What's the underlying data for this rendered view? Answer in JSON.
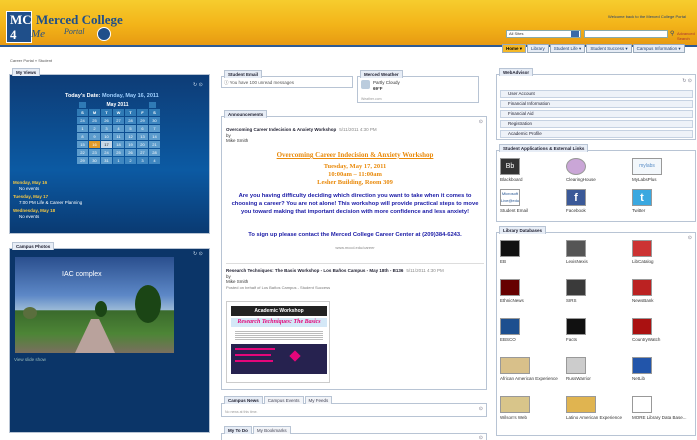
{
  "brand": {
    "name": "Merced College",
    "portal": "Portal",
    "logo_top": "MC",
    "logo_bottom": "4",
    "logo_me": "Me"
  },
  "header": {
    "welcome": "Welcome back to the Merced College Portal",
    "search_scope": "All Sites",
    "search_value": "",
    "search_advanced": "Advanced Search"
  },
  "nav": [
    "Home ▾",
    "Library",
    "Student Life ▾",
    "Student Success ▾",
    "Campus Information ▾"
  ],
  "breadcrumb": "Career Portal  »  Student",
  "my_views": {
    "tab": "My Views",
    "today_label": "Today's Date:",
    "today_value": "Monday, May 16, 2011",
    "month": "May 2011",
    "days": [
      "S",
      "M",
      "T",
      "W",
      "T",
      "F",
      "S"
    ],
    "weeks": [
      [
        "24",
        "25",
        "26",
        "27",
        "28",
        "29",
        "30"
      ],
      [
        "1",
        "2",
        "3",
        "4",
        "5",
        "6",
        "7"
      ],
      [
        "8",
        "9",
        "10",
        "11",
        "12",
        "13",
        "14"
      ],
      [
        "15",
        "16",
        "17",
        "18",
        "19",
        "20",
        "21"
      ],
      [
        "22",
        "23",
        "24",
        "25",
        "26",
        "27",
        "28"
      ],
      [
        "29",
        "30",
        "31",
        "1",
        "2",
        "3",
        "4"
      ]
    ],
    "events": [
      {
        "kind": "d",
        "text": "Monday, May 16"
      },
      {
        "kind": "e",
        "text": "No events"
      },
      {
        "kind": "d",
        "text": "Tuesday, May 17"
      },
      {
        "kind": "e",
        "text": "7:00 PM     Life & Career Planning"
      },
      {
        "kind": "d",
        "text": "Wednesday, May 18"
      },
      {
        "kind": "e",
        "text": "No events"
      }
    ]
  },
  "photos": {
    "tab": "Campus Photos",
    "caption": "IAC complex",
    "view": "View slide show"
  },
  "email": {
    "tab": "Student Email",
    "text": "ⓘ You have 100 unread messages"
  },
  "weather": {
    "tab": "Merced Weather",
    "cond": "Partly Cloudy",
    "temp": "69°F",
    "more": "Weather.com"
  },
  "announcements": {
    "tab": "Announcements",
    "a1_title": "Overcoming Career Indecision & Anxiety Workshop",
    "a1_date": "5/11/2011 4:30 PM",
    "a1_by": "by",
    "a1_author": "Mike Smith",
    "a1_head": "Overcoming Career Indecision & Anxiety Workshop",
    "a1_when": "Tuesday, May 17, 2011",
    "a1_time": "10:00am – 11:00am",
    "a1_where": "Lesher Building, Room 309",
    "a1_body": "Are you having difficulty deciding which direction you want to take when it comes to choosing a career? You are not alone! This workshop will provide practical steps to move you toward making that important decision with more confidence and less anxiety!",
    "a1_signup": "To sign up please contact the Merced College Career Center at (209)384-6243.",
    "a1_url": "www.mccd.edu/career",
    "a2_title": "Research Techniques: The Basis Workshop - Los Baños Campus - May 18th - B136",
    "a2_date": "5/11/2011 4:30 PM",
    "a2_by": "by",
    "a2_author": "Mike Smith",
    "a2_posted": "Posted on behalf of Los Baños Campus - Student Success",
    "fly_a": "Academic      Workshop",
    "fly_b": "Research Techniques: The Basics"
  },
  "news_tabs": [
    "Campus News",
    "Campus Events",
    "My Feeds"
  ],
  "news_text": "No news at this time.",
  "todo_tabs": [
    "My To Do",
    "My Bookmarks"
  ],
  "webadvisor": {
    "tab": "WebAdvisor",
    "rows": [
      "User Account",
      "Financial Information",
      "Financial Aid",
      "Registration",
      "Academic Profile"
    ]
  },
  "apps": {
    "tab": "Student Applications & External Links",
    "items": [
      "Blackboard",
      "ClearingHouse",
      "MyLabsPlus",
      "Student Email",
      "Facebook",
      "Twitter"
    ]
  },
  "library": {
    "tab": "Library Databases",
    "items": [
      "EB",
      "LexisNexis",
      "LibCatalog",
      "EthnicNews",
      "SIRS",
      "NewsBank",
      "EBSCO",
      "Facts",
      "CountryWatch",
      "African American Experience",
      "RussWarrior",
      "NetLib",
      "Wilson's Web",
      "Latino American Experience",
      "MORE Library Data Base..."
    ]
  },
  "colors": {
    "header_gold": "#f3b419",
    "navy": "#1f4f8a",
    "today": "#e19b2b"
  }
}
